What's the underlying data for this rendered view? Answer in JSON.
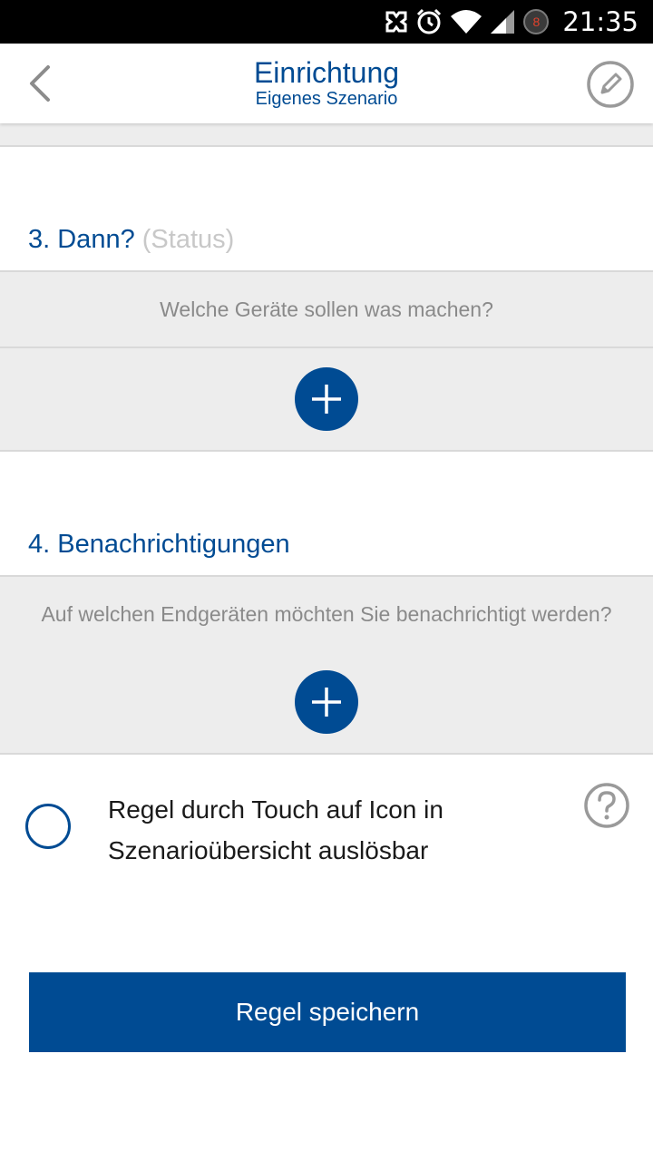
{
  "status_bar": {
    "time": "21:35",
    "badge_count": "8",
    "icons": [
      "nfc-icon",
      "alarm-icon",
      "wifi-icon",
      "cell-signal-icon",
      "notification-badge-icon"
    ]
  },
  "header": {
    "title": "Einrichtung",
    "subtitle": "Eigenes Szenario",
    "back_icon": "chevron-left-icon",
    "edit_icon": "pencil-icon"
  },
  "sections": {
    "dann": {
      "title": "3. Dann?",
      "title_suffix": "(Status)",
      "hint": "Welche Geräte sollen was machen?"
    },
    "benachrichtigungen": {
      "title": "4. Benachrichtigungen",
      "hint": "Auf welchen Endgeräten möchten Sie benachrichtigt werden?"
    }
  },
  "option": {
    "label": "Regel durch Touch auf Icon in Szenarioübersicht auslösbar",
    "checked": false
  },
  "save_button": {
    "label": "Regel speichern"
  },
  "colors": {
    "primary": "#004b93",
    "band": "#ededed",
    "muted_text": "#8a8a8a",
    "muted_title": "#c8c8c8"
  }
}
